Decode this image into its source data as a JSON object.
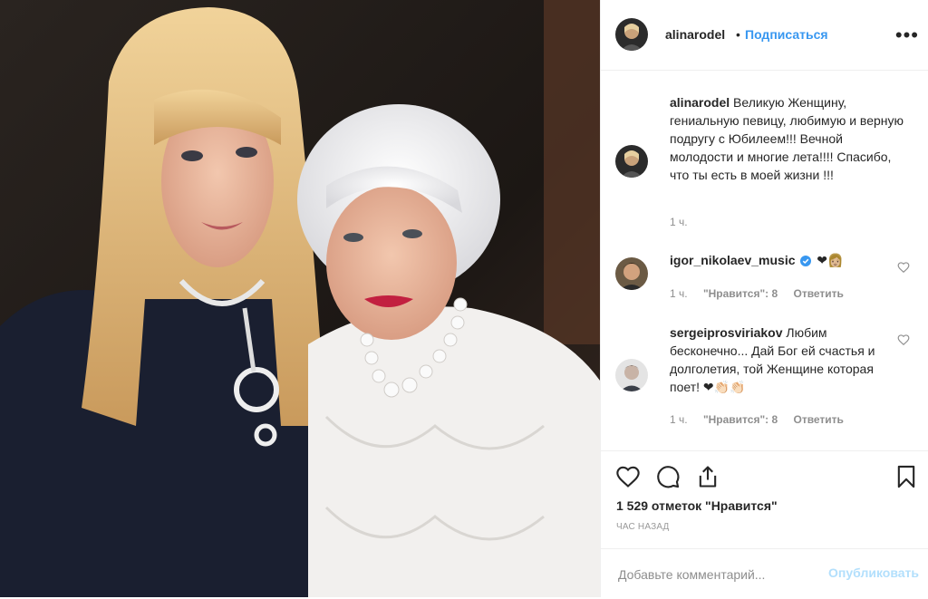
{
  "post": {
    "photo_alt": "Photo of two women",
    "author": "alinarodel",
    "follow_label": "Подписаться",
    "dot": "•",
    "more_label": "•••"
  },
  "caption": {
    "username": "alinarodel",
    "text": "Великую Женщину, гениальную певицу, любимую и верную подругу с Юбилеем!!! Вечной молодости и многие лета!!!! Спасибо, что ты есть в моей жизни !!!",
    "time": "1 ч."
  },
  "comments": [
    {
      "username": "igor_nikolaev_music",
      "verified": true,
      "text": "❤👩🏼",
      "time": "1 ч.",
      "likes": "\"Нравится\": 8",
      "reply": "Ответить"
    },
    {
      "username": "sergeiprosviriakov",
      "verified": false,
      "text": "Любим бесконечно... Дай Бог ей счастья и долголетия, той Женщине которая поет! ❤👏🏻👏🏻",
      "time": "1 ч.",
      "likes": "\"Нравится\": 8",
      "reply": "Ответить"
    }
  ],
  "actions": {
    "icons": [
      "heart-icon",
      "comment-icon",
      "share-icon",
      "bookmark-icon"
    ],
    "likes_count": "1 529 отметок \"Нравится\"",
    "timestamp": "ЧАС НАЗАД"
  },
  "add_comment": {
    "placeholder": "Добавьте комментарий...",
    "publish_label": "Опубликовать"
  },
  "colors": {
    "accent": "#3897f0",
    "publish_disabled": "#b2dffc",
    "heart_red": "#ed4956",
    "verified": "#3897f0"
  }
}
